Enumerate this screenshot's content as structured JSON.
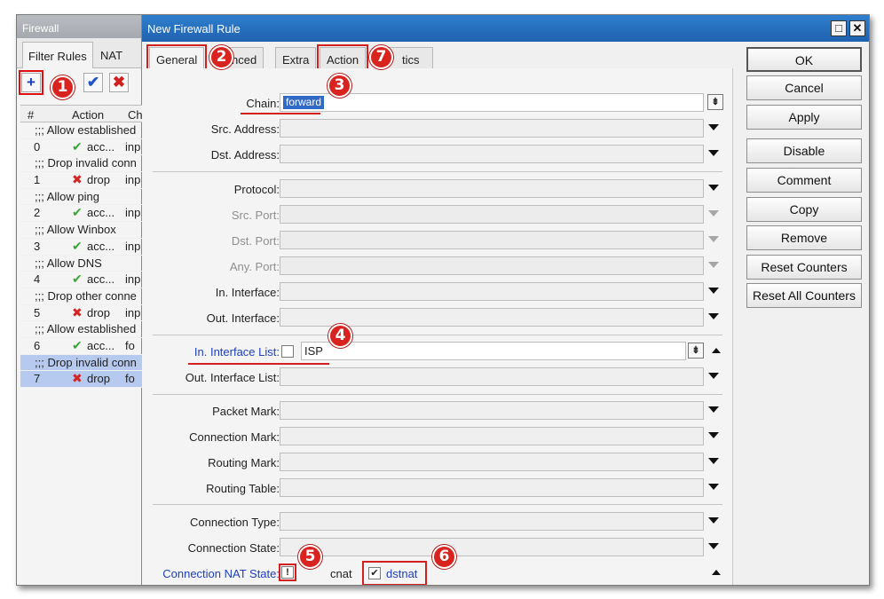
{
  "firewall": {
    "title": "Firewall",
    "tabs": [
      "Filter Rules",
      "NAT"
    ],
    "toolbar": {
      "add": "+",
      "enable": "✔",
      "disable": "✖"
    },
    "columns": [
      "#",
      "Action",
      "Ch"
    ],
    "rows": [
      {
        "type": "comment",
        "text": ";;; Allow established"
      },
      {
        "type": "rule",
        "num": "0",
        "icon": "check-icon",
        "action": "acc...",
        "chain": "inp"
      },
      {
        "type": "comment",
        "text": ";;; Drop invalid conn"
      },
      {
        "type": "rule",
        "num": "1",
        "icon": "drop-icon",
        "action": "drop",
        "chain": "inp"
      },
      {
        "type": "comment",
        "text": ";;; Allow ping"
      },
      {
        "type": "rule",
        "num": "2",
        "icon": "check-icon",
        "action": "acc...",
        "chain": "inp"
      },
      {
        "type": "comment",
        "text": ";;; Allow Winbox"
      },
      {
        "type": "rule",
        "num": "3",
        "icon": "check-icon",
        "action": "acc...",
        "chain": "inp"
      },
      {
        "type": "comment",
        "text": ";;; Allow DNS"
      },
      {
        "type": "rule",
        "num": "4",
        "icon": "check-icon",
        "action": "acc...",
        "chain": "inp"
      },
      {
        "type": "comment",
        "text": ";;; Drop other conne"
      },
      {
        "type": "rule",
        "num": "5",
        "icon": "drop-icon",
        "action": "drop",
        "chain": "inp"
      },
      {
        "type": "comment",
        "text": ";;; Allow established"
      },
      {
        "type": "rule",
        "num": "6",
        "icon": "check-icon",
        "action": "acc...",
        "chain": "fo"
      },
      {
        "type": "comment",
        "text": ";;; Drop invalid conn",
        "selected": true
      },
      {
        "type": "rule",
        "num": "7",
        "icon": "drop-icon",
        "action": "drop",
        "chain": "fo",
        "selected": true
      }
    ]
  },
  "dialog": {
    "title": "New Firewall Rule",
    "window_buttons": [
      "□",
      "✕"
    ],
    "tabs": [
      "General",
      "nced",
      "Extra",
      "Action",
      "tics"
    ],
    "chain": {
      "label": "Chain:",
      "value": "forward"
    },
    "src_address": "Src. Address:",
    "dst_address": "Dst. Address:",
    "protocol": "Protocol:",
    "src_port": "Src. Port:",
    "dst_port": "Dst. Port:",
    "any_port": "Any. Port:",
    "in_interface": "In. Interface:",
    "out_interface": "Out. Interface:",
    "in_interface_list": {
      "label": "In. Interface List:",
      "value": "ISP"
    },
    "out_interface_list": "Out. Interface List:",
    "packet_mark": "Packet Mark:",
    "connection_mark": "Connection Mark:",
    "routing_mark": "Routing Mark:",
    "routing_table": "Routing Table:",
    "connection_type": "Connection Type:",
    "connection_state": "Connection State:",
    "connection_nat_state": {
      "label": "Connection NAT State:",
      "not_mark": "!",
      "option_partial": "cnat",
      "option_checked": "dstnat"
    },
    "buttons": [
      "OK",
      "Cancel",
      "Apply",
      "Disable",
      "Comment",
      "Copy",
      "Remove",
      "Reset Counters",
      "Reset All Counters"
    ]
  },
  "annotations": [
    "1",
    "2",
    "3",
    "4",
    "5",
    "6",
    "7"
  ],
  "colors": {
    "title_bar": "#1f62b0",
    "highlight": "#d21f1f",
    "selection": "#3169c6",
    "row_selected": "#b6c9ef"
  }
}
